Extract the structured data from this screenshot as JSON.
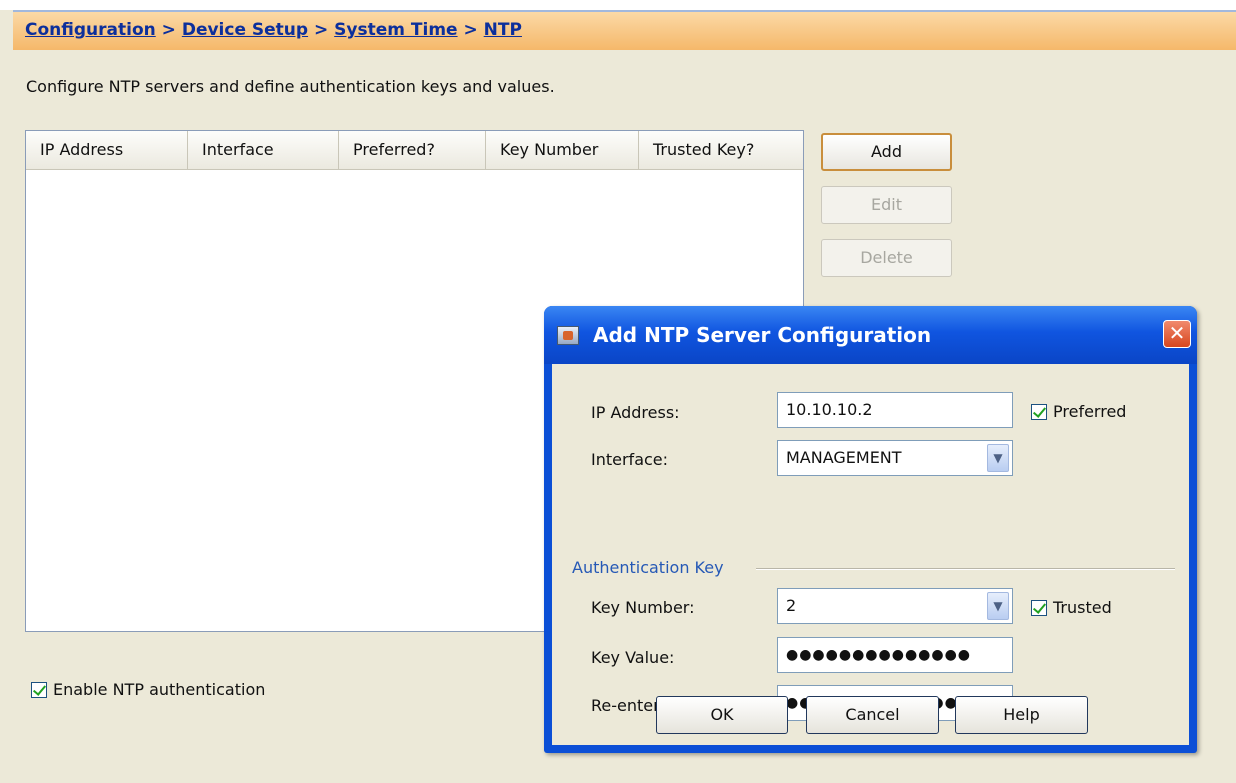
{
  "breadcrumb": {
    "items": [
      "Configuration",
      "Device Setup",
      "System Time",
      "NTP"
    ],
    "separator": ">"
  },
  "description": "Configure NTP servers and define authentication keys and values.",
  "table": {
    "columns": [
      "IP Address",
      "Interface",
      "Preferred?",
      "Key Number",
      "Trusted Key?"
    ],
    "rows": []
  },
  "side_buttons": {
    "add": "Add",
    "edit": "Edit",
    "delete": "Delete"
  },
  "enable_auth": {
    "label": "Enable NTP authentication",
    "checked": true
  },
  "dialog": {
    "title": "Add NTP Server Configuration",
    "close_glyph": "✕",
    "ip_address": {
      "label": "IP Address:",
      "value": "10.10.10.2"
    },
    "preferred": {
      "label": "Preferred",
      "checked": true
    },
    "interface": {
      "label": "Interface:",
      "value": "MANAGEMENT"
    },
    "auth_section": "Authentication Key",
    "key_number": {
      "label": "Key Number:",
      "value": "2"
    },
    "trusted": {
      "label": "Trusted",
      "checked": true
    },
    "key_value": {
      "label": "Key Value:",
      "value": "●●●●●●●●●●●●●●"
    },
    "reenter_key_value": {
      "label": "Re-enter Key Value:",
      "value": "●●●●●●●●●●●●●●"
    },
    "buttons": {
      "ok": "OK",
      "cancel": "Cancel",
      "help": "Help"
    }
  },
  "colors": {
    "breadcrumb_text": "#0c2f9c",
    "panel_bg": "#ece9d8",
    "dialog_title_bar": "#0b4fd6",
    "section_label": "#2659b6"
  }
}
